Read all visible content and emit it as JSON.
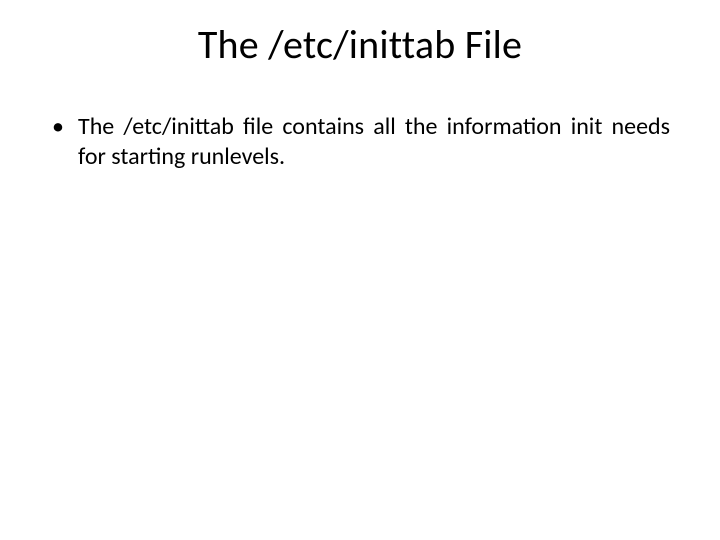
{
  "slide": {
    "title": "The /etc/inittab File",
    "bullets": [
      {
        "marker": "•",
        "text": "The /etc/inittab file contains all the information init needs for starting runlevels."
      }
    ]
  }
}
